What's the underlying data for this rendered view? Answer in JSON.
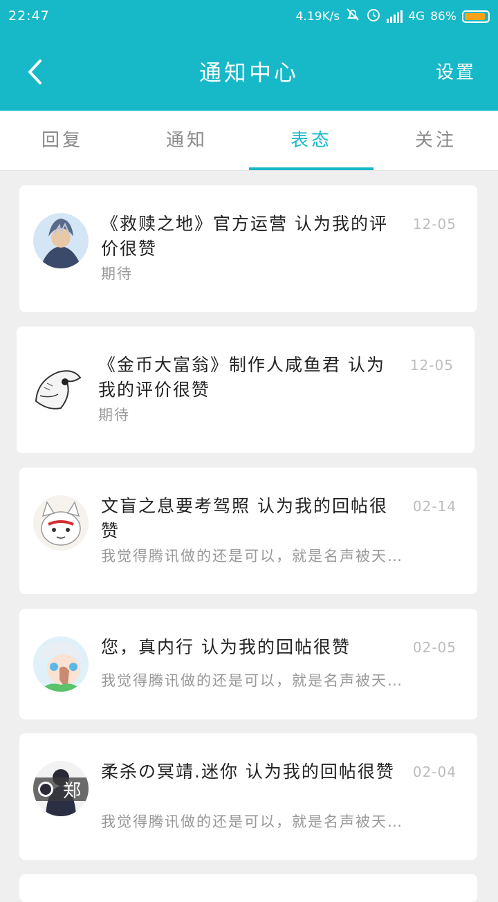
{
  "status_bar": {
    "time": "22:47",
    "speed": "4.19K/s",
    "network": "4G",
    "battery": "86%",
    "icons": [
      "mute-bell-icon",
      "alarm-icon",
      "signal-icon",
      "battery-icon"
    ]
  },
  "navbar": {
    "title": "通知中心",
    "settings_label": "设置"
  },
  "tabs": [
    "回复",
    "通知",
    "表态",
    "关注"
  ],
  "active_tab": 2,
  "notifications": [
    {
      "message": "《救赎之地》官方运营 认为我的评价很赞",
      "date": "12-05",
      "sub": "期待"
    },
    {
      "message": "《金币大富翁》制作人咸鱼君 认为我的评价很赞",
      "date": "12-05",
      "sub": "期待"
    },
    {
      "message": "文盲之息要考驾照 认为我的回帖很赞",
      "date": "02-14",
      "sub": "我觉得腾讯做的还是可以，就是名声被天…"
    },
    {
      "message": "您，真内行 认为我的回帖很赞",
      "date": "02-05",
      "sub": "我觉得腾讯做的还是可以，就是名声被天…"
    },
    {
      "message": "柔杀の冥靖.迷你 认为我的回帖很赞",
      "date": "02-04",
      "sub": "我觉得腾讯做的还是可以，就是名声被天…",
      "avatar_text": "郑"
    }
  ],
  "colors": {
    "primary": "#17b8c8",
    "background": "#efefef",
    "card": "#ffffff",
    "battery": "#f8a21c"
  }
}
